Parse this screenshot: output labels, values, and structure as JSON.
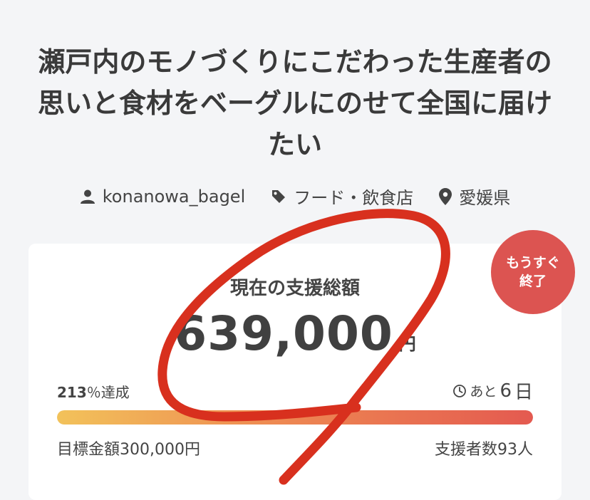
{
  "project": {
    "title": "瀬戸内のモノづくりにこだわった生産者の思いと食材をベーグルにのせて全国に届けたい",
    "owner": "konanowa_bagel",
    "category": "フード・飲食店",
    "location": "愛媛県"
  },
  "badge": {
    "line1": "もうすぐ",
    "line2": "終了"
  },
  "funding": {
    "label": "現在の支援総額",
    "amount": "639,000",
    "currency": "円",
    "achieved_num": "213",
    "achieved_suffix": "％達成",
    "remaining_prefix": "あと",
    "remaining_days": "6",
    "remaining_unit": "日",
    "goal_text": "目標金額300,000円",
    "backers_text": "支援者数93人",
    "progress_fraction": 1.0
  },
  "colors": {
    "badge": "#dc5451",
    "bar_start": "#f2c25a",
    "bar_end": "#e45a50",
    "scribble": "#d8301e"
  },
  "icons": {
    "owner": "person-icon",
    "category": "tag-icon",
    "location": "map-pin-icon",
    "remaining": "clock-icon"
  }
}
